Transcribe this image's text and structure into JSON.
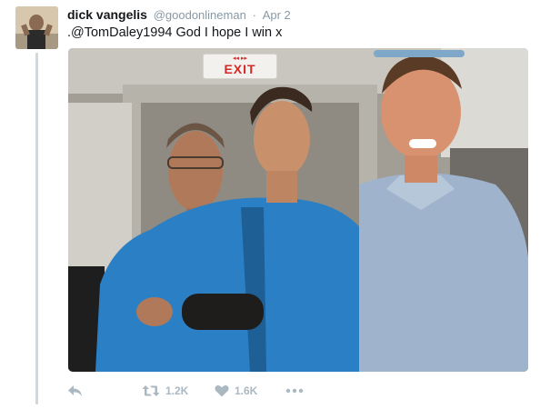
{
  "tweet": {
    "author_name": "dick vangelis",
    "handle": "@goodonlineman",
    "separator": "·",
    "date": "Apr 2",
    "text": ".@TomDaley1994 God I hope I win x"
  },
  "media": {
    "exit_label": "EXIT",
    "exit_arrows": "◂◂ ▸▸"
  },
  "actions": {
    "reply_icon": "reply-icon",
    "retweet_icon": "retweet-icon",
    "retweet_count": "1.2K",
    "like_icon": "heart-icon",
    "like_count": "1.6K",
    "more_icon": "more-dots-icon"
  },
  "colors": {
    "text": "#14171a",
    "muted": "#8899a6",
    "action_gray": "#aab8c2",
    "thread_line": "#cfd8dc"
  }
}
